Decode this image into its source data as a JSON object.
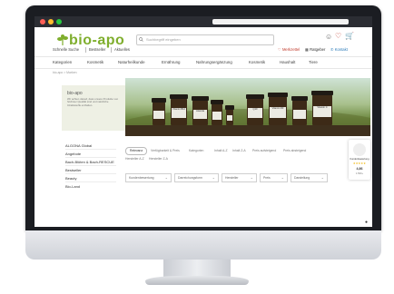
{
  "header": {
    "logo": "bio-apo",
    "search_placeholder": "Suchbegriff eingeben"
  },
  "subnav": [
    "Schnelle Suche",
    "Bestseller",
    "Aktuelles"
  ],
  "header_right": {
    "merkzettel": "Merkzettel",
    "ratgeber": "Ratgeber",
    "kontakt": "Kontakt"
  },
  "main_nav": [
    "Kategorien",
    "Kosmetik",
    "Naturheilkunde",
    "Ernährung",
    "Nahrungsergänzung",
    "Kosmetik",
    "Haushalt",
    "Tiere"
  ],
  "breadcrumb": "bio-apo  >  Marken",
  "infobox": {
    "title": "bio-apo",
    "description": "Wir achten darauf, dass unsere Produkte von höchster Qualität sind und natürliche Inhaltsstoffe enthalten."
  },
  "hero": {
    "jar_labels": [
      "",
      "Vitamin B12",
      "Acerola",
      "",
      "",
      "Q10",
      "Vitamin D3",
      "",
      "Vitamin C"
    ]
  },
  "sidebar": [
    "ALGONA Global",
    "Angebote",
    "Bach-Blüten & Bach-RESCUE",
    "Bestseller",
    "Beauty",
    "Bio-Land"
  ],
  "filters": {
    "chips": [
      "Relevanz",
      "Verfügbarkeit & Preis",
      "Kategorien",
      "Inhalt A-Z",
      "Inhalt Z-A",
      "Preis aufsteigend",
      "Preis absteigend"
    ],
    "chips_row2": [
      "Hersteller A-Z",
      "Hersteller Z-A"
    ],
    "dropdowns": [
      "Kundenbewertung",
      "Darreichungsform",
      "Hersteller",
      "Preis",
      "Darstellung"
    ]
  },
  "trust_badge": {
    "label": "Kundenbewertung",
    "stars": "★★★★★",
    "score": "4,86",
    "count": "1.500+"
  },
  "colors": {
    "brand": "#7fae2d",
    "bezel": "#1b1d22",
    "chrome": "#2b2d33"
  }
}
